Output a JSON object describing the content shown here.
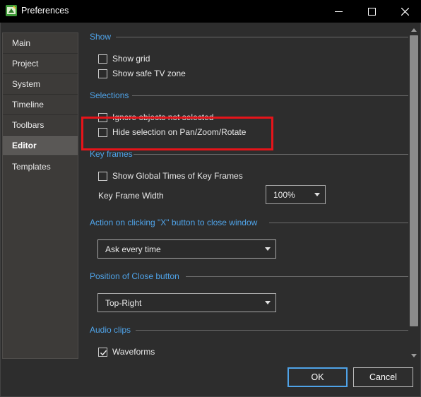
{
  "window": {
    "title": "Preferences"
  },
  "sidebar": {
    "items": [
      {
        "label": "Main"
      },
      {
        "label": "Project"
      },
      {
        "label": "System"
      },
      {
        "label": "Timeline"
      },
      {
        "label": "Toolbars"
      },
      {
        "label": "Editor",
        "active": true
      },
      {
        "label": "Templates"
      }
    ]
  },
  "sections": {
    "show": {
      "title": "Show",
      "show_grid": {
        "label": "Show grid",
        "checked": false
      },
      "show_safe_tv_zone": {
        "label": "Show safe TV zone",
        "checked": false
      }
    },
    "selections": {
      "title": "Selections",
      "ignore_objects": {
        "label": "Ignore objects not selected",
        "checked": false
      },
      "hide_selection": {
        "label": "Hide selection on Pan/Zoom/Rotate",
        "checked": false
      }
    },
    "key_frames": {
      "title": "Key frames",
      "show_global_times": {
        "label": "Show Global Times of Key Frames",
        "checked": false
      },
      "width_label": "Key Frame Width",
      "width_value": "100%"
    },
    "close_action": {
      "title": "Action on clicking \"X\" button to close window",
      "value": "Ask every time"
    },
    "close_position": {
      "title": "Position of Close button",
      "value": "Top-Right"
    },
    "audio_clips": {
      "title": "Audio clips",
      "waveforms": {
        "label": "Waveforms",
        "checked": true
      }
    }
  },
  "buttons": {
    "ok": "OK",
    "cancel": "Cancel"
  },
  "colors": {
    "accent": "#4fa3e8",
    "highlight": "#e5141a",
    "background": "#2d2d2d"
  }
}
